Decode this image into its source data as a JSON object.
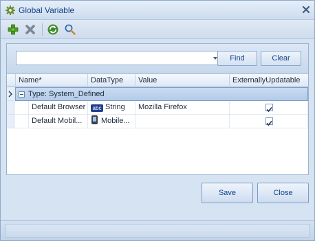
{
  "window": {
    "title": "Global Variable",
    "close_symbol": "✕"
  },
  "toolbar": {
    "items": [
      {
        "name": "add-icon",
        "kind": "icon"
      },
      {
        "name": "delete-icon",
        "kind": "icon"
      },
      {
        "name": "refresh-icon",
        "kind": "icon"
      },
      {
        "name": "search-zoom-icon",
        "kind": "icon"
      }
    ]
  },
  "search": {
    "value": "",
    "find_label": "Find",
    "clear_label": "Clear"
  },
  "grid": {
    "columns": [
      "Name*",
      "DataType",
      "Value",
      "ExternallyUpdatable"
    ],
    "group_label": "Type: System_Defined",
    "rows": [
      {
        "name": "Default Browser",
        "type_icon": "abc",
        "datatype": "String",
        "value": "Mozilla Firefox",
        "externally_updatable": true
      },
      {
        "name": "Default Mobil...",
        "type_icon": "mobile-icon",
        "datatype": "Mobile...",
        "value": "",
        "externally_updatable": true
      }
    ]
  },
  "footer": {
    "save_label": "Save",
    "close_label": "Close"
  },
  "colors": {
    "accent": "#15428b",
    "border": "#8fa9c8",
    "background": "#d6e3f2"
  }
}
